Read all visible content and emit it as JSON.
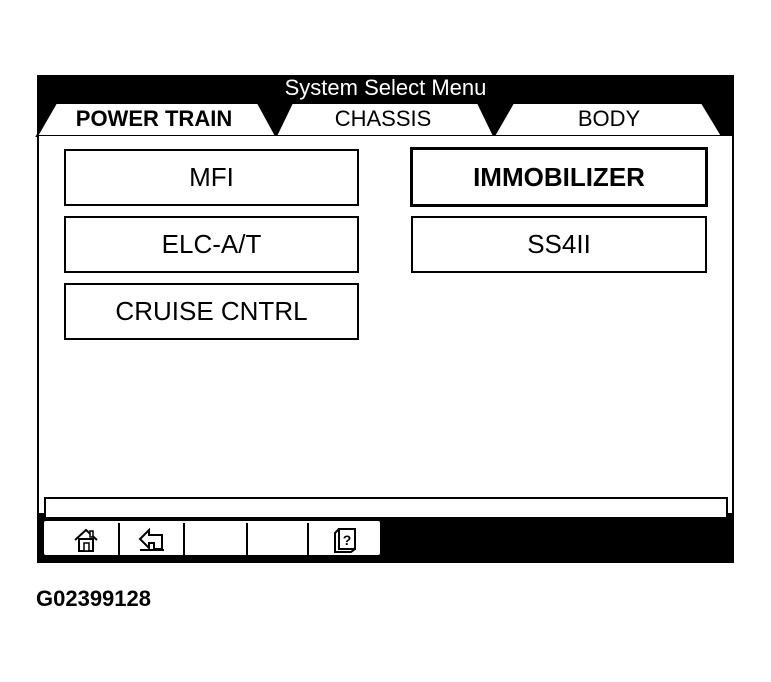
{
  "window": {
    "title": "System Select Menu"
  },
  "tabs": [
    {
      "label": "POWER TRAIN",
      "active": true
    },
    {
      "label": "CHASSIS",
      "active": false
    },
    {
      "label": "BODY",
      "active": false
    }
  ],
  "systems": {
    "mfi": "MFI",
    "elc": "ELC-A/T",
    "cruise": "CRUISE CNTRL",
    "immobilizer": "IMMOBILIZER",
    "ss4": "SS4II"
  },
  "toolbar": {
    "icons": [
      "home-icon",
      "back-arrow-icon",
      "",
      "",
      "help-book-icon"
    ]
  },
  "figure": {
    "id": "G02399128"
  },
  "colors": {
    "frame": "#000000",
    "panel": "#ffffff"
  }
}
